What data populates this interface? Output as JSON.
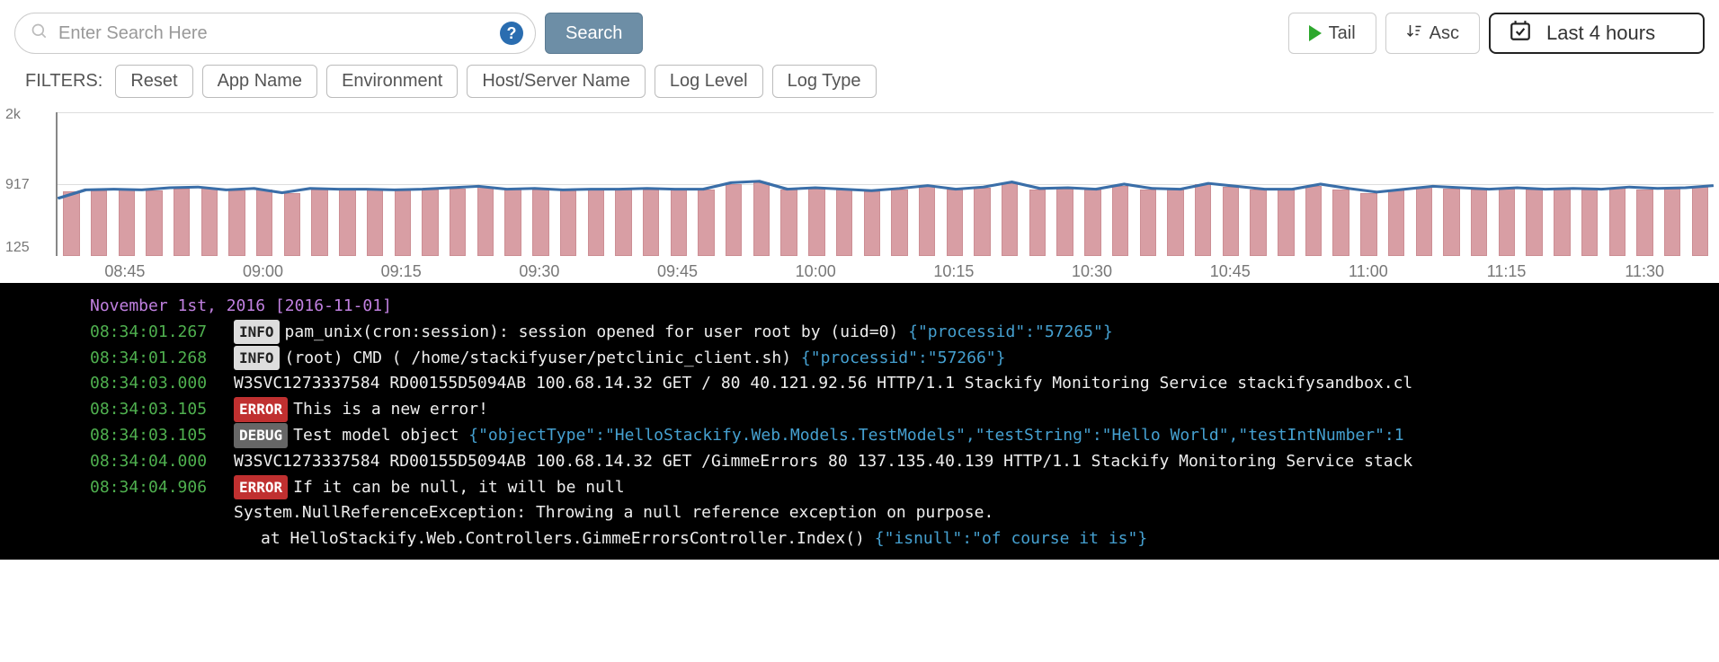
{
  "search": {
    "placeholder": "Enter Search Here",
    "button_label": "Search"
  },
  "top_buttons": {
    "tail": "Tail",
    "asc": "Asc",
    "time_range": "Last 4 hours"
  },
  "filters": {
    "label": "FILTERS:",
    "reset": "Reset",
    "items": [
      "App Name",
      "Environment",
      "Host/Server Name",
      "Log Level",
      "Log Type"
    ]
  },
  "chart_data": {
    "type": "bar",
    "y_ticks": [
      "2k",
      "917",
      "125"
    ],
    "ylim": [
      0,
      2000
    ],
    "categories": [
      "08:45",
      "09:00",
      "09:15",
      "09:30",
      "09:45",
      "10:00",
      "10:15",
      "10:30",
      "10:45",
      "11:00",
      "11:15",
      "11:30"
    ],
    "series": [
      {
        "name": "bars",
        "values": [
          900,
          910,
          920,
          910,
          940,
          950,
          910,
          920,
          880,
          930,
          920,
          920,
          910,
          920,
          940,
          960,
          920,
          930,
          910,
          920,
          920,
          930,
          920,
          920,
          1000,
          1020,
          920,
          940,
          920,
          900,
          930,
          970,
          920,
          950,
          1010,
          930,
          940,
          920,
          980,
          920,
          920,
          1000,
          960,
          920,
          920,
          980,
          930,
          880,
          920,
          960,
          940,
          920,
          940,
          920,
          930,
          920,
          950,
          930,
          940,
          960
        ]
      },
      {
        "name": "line",
        "values": [
          800,
          920,
          930,
          920,
          950,
          960,
          920,
          940,
          880,
          940,
          930,
          930,
          920,
          930,
          950,
          970,
          930,
          940,
          920,
          930,
          930,
          940,
          930,
          930,
          1020,
          1040,
          930,
          950,
          930,
          910,
          940,
          980,
          930,
          960,
          1030,
          940,
          950,
          930,
          1000,
          940,
          930,
          1010,
          970,
          930,
          930,
          1000,
          940,
          890,
          930,
          970,
          950,
          930,
          950,
          930,
          940,
          930,
          960,
          940,
          950,
          980
        ]
      }
    ]
  },
  "logs": {
    "date_header": "November 1st, 2016 [2016-11-01]",
    "rows": [
      {
        "time": "08:34:01.267",
        "level": "INFO",
        "msg": "pam_unix(cron:session): session opened for user root by (uid=0)",
        "json": "{\"processid\":\"57265\"}"
      },
      {
        "time": "08:34:01.268",
        "level": "INFO",
        "msg": "(root) CMD (   /home/stackifyuser/petclinic_client.sh)",
        "json": "{\"processid\":\"57266\"}"
      },
      {
        "time": "08:34:03.000",
        "level": "",
        "msg": "W3SVC1273337584 RD00155D5094AB 100.68.14.32 GET / 80 40.121.92.56 HTTP/1.1 Stackify Monitoring Service stackifysandbox.cl",
        "json": ""
      },
      {
        "time": "08:34:03.105",
        "level": "ERROR",
        "msg": "This is a new error!",
        "json": ""
      },
      {
        "time": "08:34:03.105",
        "level": "DEBUG",
        "msg": "Test model object",
        "json": "{\"objectType\":\"HelloStackify.Web.Models.TestModels\",\"testString\":\"Hello World\",\"testIntNumber\":1"
      },
      {
        "time": "08:34:04.000",
        "level": "",
        "msg": "W3SVC1273337584 RD00155D5094AB 100.68.14.32 GET /GimmeErrors 80 137.135.40.139 HTTP/1.1 Stackify Monitoring Service stack",
        "json": ""
      },
      {
        "time": "08:34:04.906",
        "level": "ERROR",
        "msg": "If it can be null, it will be null",
        "json": ""
      }
    ],
    "stack": {
      "l1": "System.NullReferenceException: Throwing a null reference exception on purpose.",
      "l2": "at HelloStackify.Web.Controllers.GimmeErrorsController.Index()",
      "l2_json": "{\"isnull\":\"of course it is\"}"
    }
  }
}
